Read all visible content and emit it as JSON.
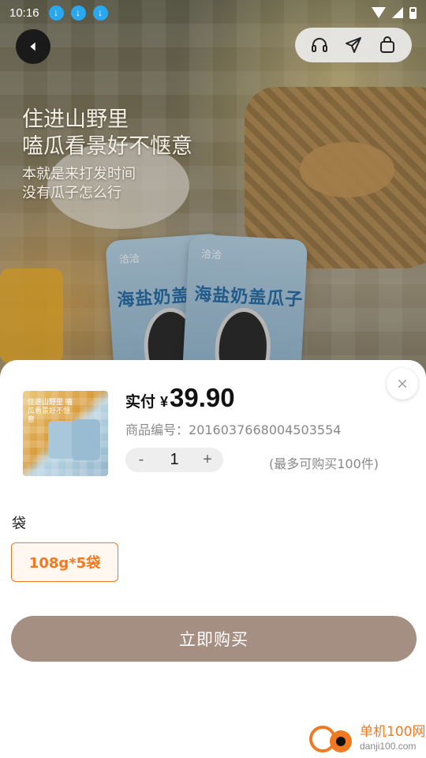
{
  "status_bar": {
    "time": "10:16",
    "download_icons": [
      "download-icon",
      "download-icon",
      "download-icon"
    ]
  },
  "colors": {
    "accent": "#f07a22",
    "buy_button": "#a58f82",
    "download_badge": "#29a8f0"
  },
  "hero": {
    "line1": "住进山野里",
    "line2": "嗑瓜看景好不惬意",
    "line3": "本就是来打发时间",
    "line4": "没有瓜子怎么行",
    "pack_logo": "洽洽",
    "pack_title": "海盐奶盖瓜子"
  },
  "sheet": {
    "price_label": "实付",
    "currency": "¥",
    "price": "39.90",
    "sku_label": "商品编号：",
    "sku_value": "2016037668004503554",
    "quantity": "1",
    "minus": "-",
    "plus": "+",
    "max_note": "(最多可购买100件)",
    "spec_label": "袋",
    "spec_option": "108g*5袋",
    "buy_label": "立即购买",
    "thumb_text": "住进山野里 嗑瓜看景好不惬意"
  },
  "watermark": {
    "cn": "单机100网",
    "url": "danji100.com"
  }
}
